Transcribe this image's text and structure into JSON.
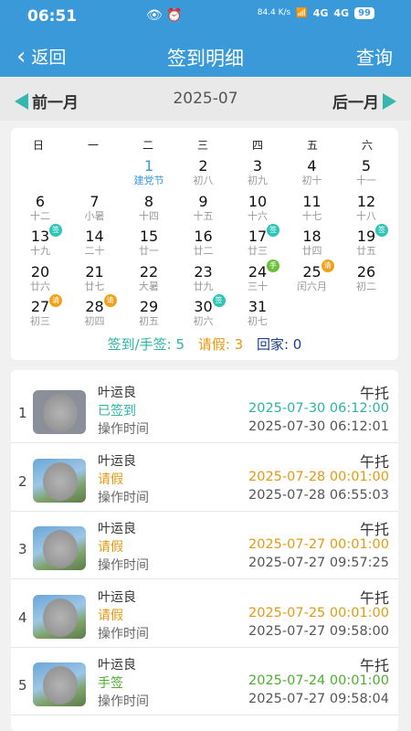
{
  "status_bar": {
    "time": "06:51",
    "icons": "👁 ⏰",
    "network_speed": "84.4 K/s",
    "signal1": "4G",
    "signal2": "4G",
    "battery": "99"
  },
  "header": {
    "back_label": "返回",
    "title": "签到明细",
    "query_label": "查询"
  },
  "month_nav": {
    "prev_label": "前一月",
    "current": "2025-07",
    "next_label": "后一月"
  },
  "calendar": {
    "weekdays": [
      "日",
      "一",
      "二",
      "三",
      "四",
      "五",
      "六"
    ],
    "days": [
      {
        "day": "1",
        "lunar": "建党节",
        "festival": true,
        "today": true
      },
      {
        "day": "2",
        "lunar": "初八"
      },
      {
        "day": "3",
        "lunar": "初九"
      },
      {
        "day": "4",
        "lunar": "初十"
      },
      {
        "day": "5",
        "lunar": "十一"
      },
      {
        "day": "6",
        "lunar": "十二"
      },
      {
        "day": "7",
        "lunar": "小暑"
      },
      {
        "day": "8",
        "lunar": "十四"
      },
      {
        "day": "9",
        "lunar": "十五"
      },
      {
        "day": "10",
        "lunar": "十六"
      },
      {
        "day": "11",
        "lunar": "十七"
      },
      {
        "day": "12",
        "lunar": "十八"
      },
      {
        "day": "13",
        "lunar": "十九",
        "tag": "签",
        "tag_type": "sign"
      },
      {
        "day": "14",
        "lunar": "二十"
      },
      {
        "day": "15",
        "lunar": "廿一"
      },
      {
        "day": "16",
        "lunar": "廿二"
      },
      {
        "day": "17",
        "lunar": "廿三",
        "tag": "签",
        "tag_type": "sign"
      },
      {
        "day": "18",
        "lunar": "廿四"
      },
      {
        "day": "19",
        "lunar": "廿五",
        "tag": "签",
        "tag_type": "sign"
      },
      {
        "day": "20",
        "lunar": "廿六"
      },
      {
        "day": "21",
        "lunar": "廿七"
      },
      {
        "day": "22",
        "lunar": "大暑"
      },
      {
        "day": "23",
        "lunar": "廿九"
      },
      {
        "day": "24",
        "lunar": "三十",
        "tag": "手",
        "tag_type": "hand"
      },
      {
        "day": "25",
        "lunar": "闰六月",
        "tag": "请",
        "tag_type": "leave"
      },
      {
        "day": "26",
        "lunar": "初二"
      },
      {
        "day": "27",
        "lunar": "初三",
        "tag": "请",
        "tag_type": "leave"
      },
      {
        "day": "28",
        "lunar": "初四",
        "tag": "请",
        "tag_type": "leave"
      },
      {
        "day": "29",
        "lunar": "初五"
      },
      {
        "day": "30",
        "lunar": "初六",
        "tag": "签",
        "tag_type": "sign"
      },
      {
        "day": "31",
        "lunar": "初七"
      }
    ],
    "summary": {
      "sign": "签到/手签: 5",
      "leave": "请假: 3",
      "home": "回家: 0"
    }
  },
  "records": [
    {
      "index": "1",
      "name": "叶运良",
      "status": "已签到",
      "status_type": "sign",
      "op_label": "操作时间",
      "shift": "午托",
      "time1": "2025-07-30 06:12:00",
      "time2": "2025-07-30 06:12:01",
      "avatar": "a1"
    },
    {
      "index": "2",
      "name": "叶运良",
      "status": "请假",
      "status_type": "leave",
      "op_label": "操作时间",
      "shift": "午托",
      "time1": "2025-07-28 00:01:00",
      "time2": "2025-07-28 06:55:03",
      "avatar": "a2"
    },
    {
      "index": "3",
      "name": "叶运良",
      "status": "请假",
      "status_type": "leave",
      "op_label": "操作时间",
      "shift": "午托",
      "time1": "2025-07-27 00:01:00",
      "time2": "2025-07-27 09:57:25",
      "avatar": "a2"
    },
    {
      "index": "4",
      "name": "叶运良",
      "status": "请假",
      "status_type": "leave",
      "op_label": "操作时间",
      "shift": "午托",
      "time1": "2025-07-25 00:01:00",
      "time2": "2025-07-27 09:58:00",
      "avatar": "a2"
    },
    {
      "index": "5",
      "name": "叶运良",
      "status": "手签",
      "status_type": "hand",
      "op_label": "操作时间",
      "shift": "午托",
      "time1": "2025-07-24 00:01:00",
      "time2": "2025-07-27 09:58:04",
      "avatar": "a2"
    }
  ]
}
